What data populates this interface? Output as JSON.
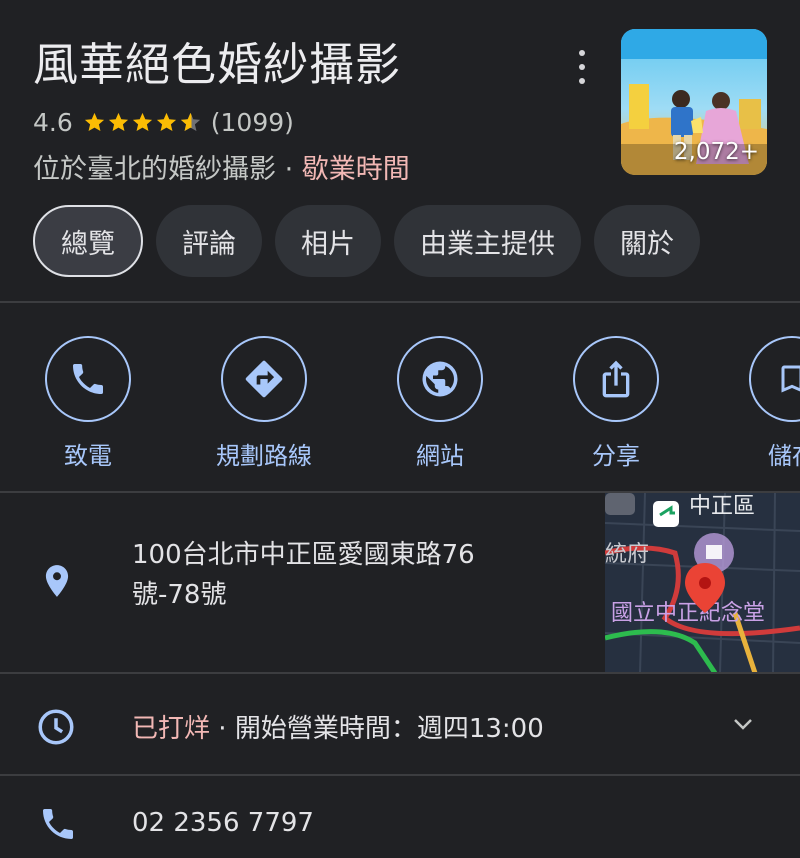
{
  "place": {
    "title": "風華絕色婚紗攝影",
    "rating": "4.6",
    "review_count": "(1099)",
    "stars": 4.6,
    "category": "位於臺北的婚紗攝影",
    "separator": " · ",
    "hours_link": "歇業時間",
    "photo_count": "2,072+"
  },
  "tabs": [
    {
      "label": "總覽",
      "active": true
    },
    {
      "label": "評論"
    },
    {
      "label": "相片"
    },
    {
      "label": "由業主提供"
    },
    {
      "label": "關於"
    }
  ],
  "actions": [
    {
      "label": "致電",
      "icon": "phone-icon"
    },
    {
      "label": "規劃路線",
      "icon": "directions-icon"
    },
    {
      "label": "網站",
      "icon": "globe-icon"
    },
    {
      "label": "分享",
      "icon": "share-icon"
    },
    {
      "label": "儲存",
      "icon": "bookmark-icon"
    }
  ],
  "address": {
    "line1": "100台北市中正區愛國東路76",
    "line2": "號-78號"
  },
  "map": {
    "district_label": "中正區",
    "landmark_label": "國立中正紀念堂",
    "nearby_label": "統府"
  },
  "hours": {
    "status": "已打烊",
    "separator": " · ",
    "next_open": "開始營業時間：週四13:00"
  },
  "phone": {
    "number": "02 2356 7797"
  },
  "colors": {
    "background": "#202124",
    "accent": "#a8c7fa",
    "closed": "#f2b8b5",
    "star": "#fbbc04"
  }
}
